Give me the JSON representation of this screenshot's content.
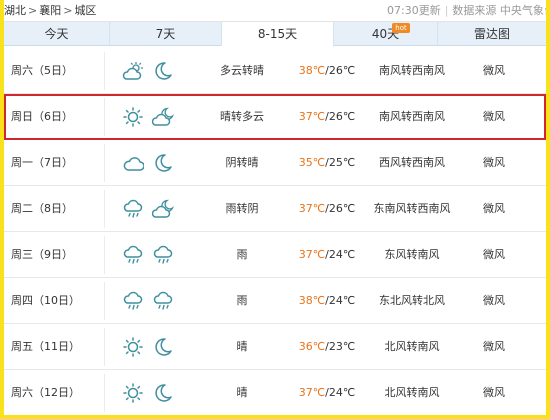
{
  "breadcrumb": [
    "湖北",
    "襄阳",
    "城区"
  ],
  "update": {
    "time": "07:30更新",
    "source": "数据来源 中央气象台"
  },
  "tabs": [
    {
      "label": "今天"
    },
    {
      "label": "7天"
    },
    {
      "label": "8-15天"
    },
    {
      "label": "40天",
      "badge": "hot"
    },
    {
      "label": "雷达图"
    }
  ],
  "rows": [
    {
      "day": "周六（5日）",
      "day_icon": "partly-cloudy-icon",
      "night_icon": "moon-icon",
      "desc": "多云转晴",
      "high": "38℃",
      "low": "/26℃",
      "wind": "南风转西南风",
      "level": "微风"
    },
    {
      "day": "周日（6日）",
      "day_icon": "sun-icon",
      "night_icon": "cloudy-moon-icon",
      "desc": "晴转多云",
      "high": "37℃",
      "low": "/26℃",
      "wind": "南风转西南风",
      "level": "微风"
    },
    {
      "day": "周一（7日）",
      "day_icon": "cloud-icon",
      "night_icon": "moon-icon",
      "desc": "阴转晴",
      "high": "35℃",
      "low": "/25℃",
      "wind": "西风转西南风",
      "level": "微风"
    },
    {
      "day": "周二（8日）",
      "day_icon": "rain-icon",
      "night_icon": "cloudy-moon-icon",
      "desc": "雨转阴",
      "high": "37℃",
      "low": "/26℃",
      "wind": "东南风转西南风",
      "level": "微风"
    },
    {
      "day": "周三（9日）",
      "day_icon": "rain-icon",
      "night_icon": "rain-icon",
      "desc": "雨",
      "high": "37℃",
      "low": "/24℃",
      "wind": "东风转南风",
      "level": "微风"
    },
    {
      "day": "周四（10日）",
      "day_icon": "rain-icon",
      "night_icon": "rain-icon",
      "desc": "雨",
      "high": "38℃",
      "low": "/24℃",
      "wind": "东北风转北风",
      "level": "微风"
    },
    {
      "day": "周五（11日）",
      "day_icon": "sun-icon",
      "night_icon": "moon-icon",
      "desc": "晴",
      "high": "36℃",
      "low": "/23℃",
      "wind": "北风转南风",
      "level": "微风"
    },
    {
      "day": "周六（12日）",
      "day_icon": "sun-icon",
      "night_icon": "moon-icon",
      "desc": "晴",
      "high": "37℃",
      "low": "/24℃",
      "wind": "北风转南风",
      "level": "微风"
    }
  ],
  "colors": {
    "background": "#f7e21c",
    "tab_bar": "#e7f0f8",
    "highlight": "#d0262e",
    "high_temp": "#e8731a",
    "icon_stroke": "#3f8f9e"
  }
}
